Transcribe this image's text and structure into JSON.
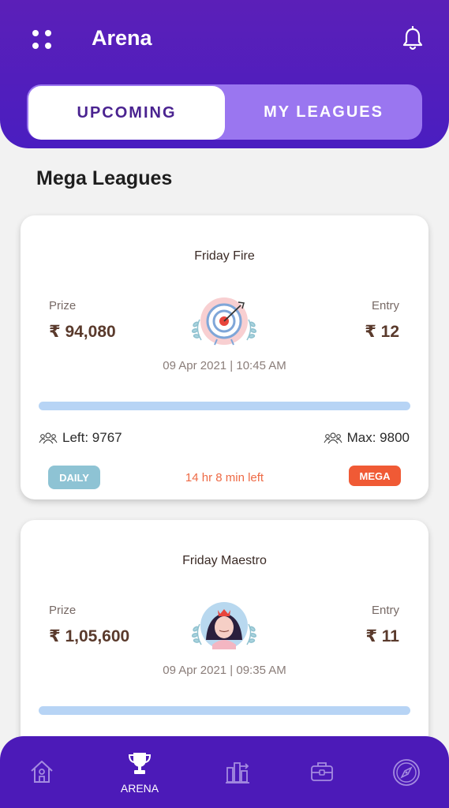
{
  "header": {
    "title": "Arena",
    "menu_icon": "grid-dots-icon",
    "notification_icon": "bell-icon"
  },
  "tabs": [
    {
      "label": "UPCOMING",
      "active": true
    },
    {
      "label": "MY LEAGUES",
      "active": false
    }
  ],
  "section_title": "Mega Leagues",
  "leagues": [
    {
      "name": "Friday Fire",
      "prize_label": "Prize",
      "prize_value": "₹ 94,080",
      "entry_label": "Entry",
      "entry_value": "₹ 12",
      "emblem_icon": "target-dart-icon",
      "datetime": "09 Apr 2021 | 10:45 AM",
      "fill_fraction": 1.0,
      "left_text": "Left: 9767",
      "max_text": "Max: 9800",
      "badge_left": "DAILY",
      "time_left": "14 hr 8 min  left",
      "badge_right": "MEGA"
    },
    {
      "name": "Friday Maestro",
      "prize_label": "Prize",
      "prize_value": "₹ 1,05,600",
      "entry_label": "Entry",
      "entry_value": "₹ 11",
      "emblem_icon": "queen-avatar-icon",
      "datetime": "09 Apr 2021 | 09:35 AM",
      "fill_fraction": 1.0
    }
  ],
  "bottom_nav": [
    {
      "icon": "home-icon",
      "label": ""
    },
    {
      "icon": "trophy-icon",
      "label": "ARENA",
      "active": true
    },
    {
      "icon": "leaderboard-icon",
      "label": ""
    },
    {
      "icon": "briefcase-icon",
      "label": ""
    },
    {
      "icon": "compass-icon",
      "label": ""
    }
  ],
  "colors": {
    "primary": "#4c1ab8",
    "tab_inactive": "#9a76f0",
    "progress": "#b7d4f5",
    "daily_badge": "#8ec3d4",
    "mega_badge": "#f05a35",
    "time_left": "#ee6a45"
  }
}
